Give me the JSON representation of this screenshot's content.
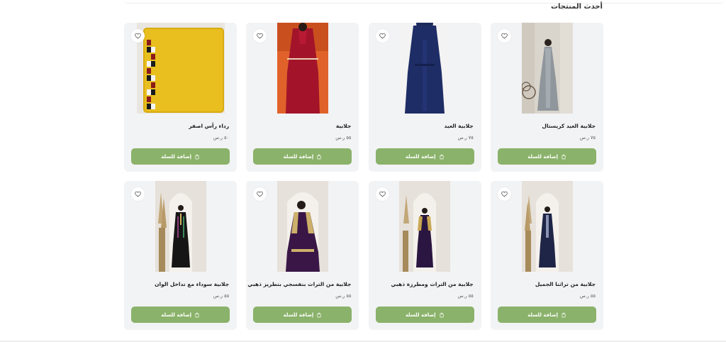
{
  "section": {
    "title": "أحدث المنتجات"
  },
  "colors": {
    "accent": "#8ab26a",
    "card_bg": "#f2f3f5"
  },
  "icons": {
    "wishlist": "heart-icon",
    "cart": "shopping-bag-icon"
  },
  "products": [
    {
      "name": "جلابية العيد كريستال",
      "price": "٧٥ ر.س",
      "button": "إضافة للسلة"
    },
    {
      "name": "جلابية العيد",
      "price": "٧٥ ر.س",
      "button": "إضافة للسلة"
    },
    {
      "name": "جلابية",
      "price": "٥٥ ر.س",
      "button": "إضافة للسلة"
    },
    {
      "name": "رداء رأس اصفر",
      "price": "٥٠ ر.س",
      "button": "إضافة للسلة"
    },
    {
      "name": "جلابية من تراثنا الجميل",
      "price": "٥٥ ر.س",
      "button": "إضافة للسلة"
    },
    {
      "name": "جلابية من التراث ومطرزة ذهبي",
      "price": "٥٥ ر.س",
      "button": "إضافة للسلة"
    },
    {
      "name": "جلابية من التراث بنفسجي بتطريز ذهبي",
      "price": "٥٥ ر.س",
      "button": "إضافة للسلة"
    },
    {
      "name": "جلابية سوداء مع تداخل الوان",
      "price": "٥٥ ر.س",
      "button": "إضافة للسلة"
    }
  ]
}
